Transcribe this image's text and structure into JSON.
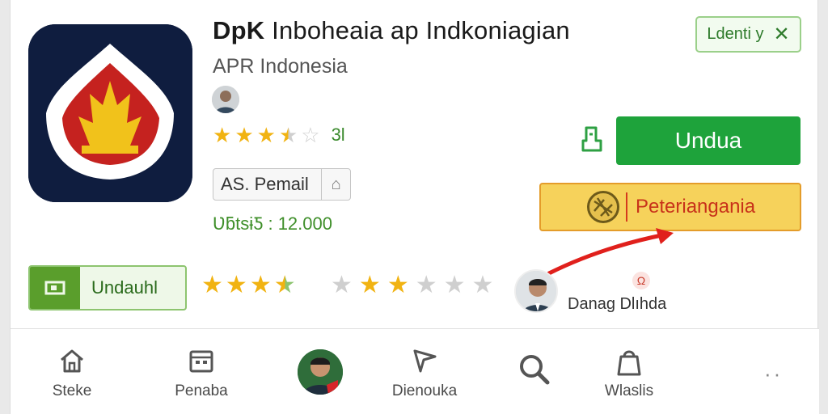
{
  "app": {
    "title_prefix": "DpK",
    "title_rest": " Inboheaia ap Indkoniagian",
    "developer": "APR Indonesia",
    "rating_count": "3l",
    "category": "AS. Pemail",
    "downloads": "ƲƃtsɨƼ : 12.000"
  },
  "header": {
    "identity_label": "Ldenti y",
    "identity_close": "✕"
  },
  "actions": {
    "install_label": "Undua",
    "promo_label": "Peteriangania"
  },
  "secondary": {
    "get_label": "Undauhl",
    "reviewer_name": "Danag Dlıhda",
    "report_glyph": "Ω"
  },
  "ratings": {
    "app_stars": 3.5,
    "row_a_stars": 3.5,
    "row_b_stars": 2
  },
  "bottom_nav": {
    "items": [
      {
        "label": "Steke",
        "icon": "home-icon"
      },
      {
        "label": "Penaba",
        "icon": "calendar-icon"
      },
      {
        "label": "",
        "icon": "avatar"
      },
      {
        "label": "Dienouka",
        "icon": "send-icon"
      },
      {
        "label": "",
        "icon": "search-icon"
      },
      {
        "label": "Wlaslis",
        "icon": "bag-icon"
      }
    ],
    "more": "··"
  },
  "colors": {
    "install": "#1ea33b",
    "promo_fill": "#f6d25b",
    "promo_border": "#e49c2a",
    "accent_green": "#3f8f2a",
    "star": "#f1b312"
  }
}
